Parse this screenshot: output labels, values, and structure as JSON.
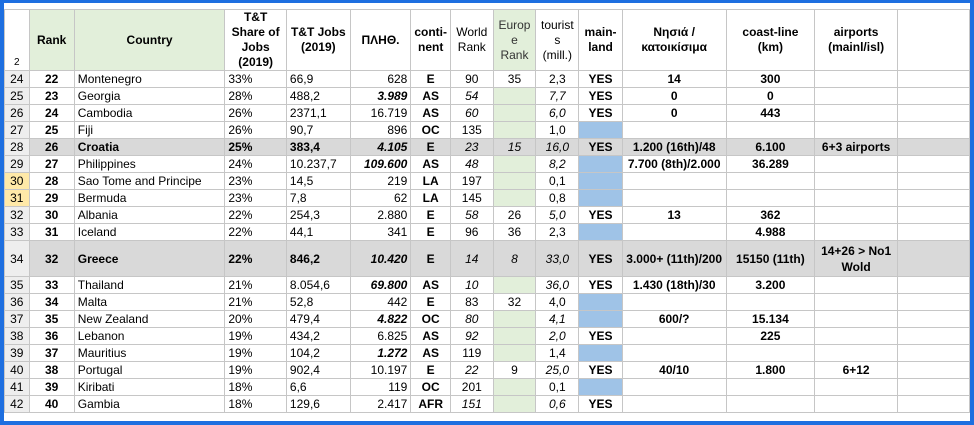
{
  "header": {
    "row_number": "2",
    "rank": "Rank",
    "country": "Country",
    "share": "T&T Share of Jobs (2019)",
    "jobs": "T&T Jobs (2019)",
    "pop": "ΠΛΗΘ.",
    "continent": "conti-nent",
    "world_rank": "World Rank",
    "europe_rank": "Europ e Rank",
    "tourists": "tourist s (mill.)",
    "mainland": "main-land",
    "islands": "Νησιά /κατοικίσιμα",
    "coastline": "coast-line (km)",
    "airports": "airports (mainl/isl)"
  },
  "rows": [
    {
      "n": "24",
      "rank": "22",
      "country": "Montenegro",
      "share": "33%",
      "jobs": "66,9",
      "pop": "628",
      "cont": "E",
      "wr": "90",
      "er": "35",
      "tour": "2,3",
      "main": "YES",
      "isl": "14",
      "coast": "300",
      "air": ""
    },
    {
      "n": "25",
      "rank": "23",
      "country": "Georgia",
      "share": "28%",
      "jobs": "488,2",
      "pop": "3.989",
      "cont": "AS",
      "wr": "54",
      "er": "",
      "tour": "7,7",
      "main": "YES",
      "isl": "0",
      "coast": "0",
      "air": ""
    },
    {
      "n": "26",
      "rank": "24",
      "country": "Cambodia",
      "share": "26%",
      "jobs": "2371,1",
      "pop": "16.719",
      "cont": "AS",
      "wr": "60",
      "er": "",
      "tour": "6,0",
      "main": "YES",
      "isl": "0",
      "coast": "443",
      "air": ""
    },
    {
      "n": "27",
      "rank": "25",
      "country": "Fiji",
      "share": "26%",
      "jobs": "90,7",
      "pop": "896",
      "cont": "OC",
      "wr": "135",
      "er": "",
      "tour": "1,0",
      "main": "",
      "isl": "",
      "coast": "",
      "air": ""
    },
    {
      "n": "28",
      "rank": "26",
      "country": "Croatia",
      "share": "25%",
      "jobs": "383,4",
      "pop": "4.105",
      "cont": "E",
      "wr": "23",
      "er": "15",
      "tour": "16,0",
      "main": "YES",
      "isl": "1.200 (16th)/48",
      "coast": "6.100",
      "air": "6+3 airports"
    },
    {
      "n": "29",
      "rank": "27",
      "country": "Philippines",
      "share": "24%",
      "jobs": "10.237,7",
      "pop": "109.600",
      "cont": "AS",
      "wr": "48",
      "er": "",
      "tour": "8,2",
      "main": "",
      "isl": "7.700 (8th)/2.000",
      "coast": "36.289",
      "air": ""
    },
    {
      "n": "30",
      "rank": "28",
      "country": "Sao Tome and Principe",
      "share": "23%",
      "jobs": "14,5",
      "pop": "219",
      "cont": "LA",
      "wr": "197",
      "er": "",
      "tour": "0,1",
      "main": "",
      "isl": "",
      "coast": "",
      "air": ""
    },
    {
      "n": "31",
      "rank": "29",
      "country": "Bermuda",
      "share": "23%",
      "jobs": "7,8",
      "pop": "62",
      "cont": "LA",
      "wr": "145",
      "er": "",
      "tour": "0,8",
      "main": "",
      "isl": "",
      "coast": "",
      "air": ""
    },
    {
      "n": "32",
      "rank": "30",
      "country": "Albania",
      "share": "22%",
      "jobs": "254,3",
      "pop": "2.880",
      "cont": "E",
      "wr": "58",
      "er": "26",
      "tour": "5,0",
      "main": "YES",
      "isl": "13",
      "coast": "362",
      "air": ""
    },
    {
      "n": "33",
      "rank": "31",
      "country": "Iceland",
      "share": "22%",
      "jobs": "44,1",
      "pop": "341",
      "cont": "E",
      "wr": "96",
      "er": "36",
      "tour": "2,3",
      "main": "",
      "isl": "",
      "coast": "4.988",
      "air": ""
    },
    {
      "n": "34",
      "rank": "32",
      "country": "Greece",
      "share": "22%",
      "jobs": "846,2",
      "pop": "10.420",
      "cont": "E",
      "wr": "14",
      "er": "8",
      "tour": "33,0",
      "main": "YES",
      "isl": "3.000+ (11th)/200",
      "coast": "15150 (11th)",
      "air": "14+26 > No1 Wold"
    },
    {
      "n": "35",
      "rank": "33",
      "country": "Thailand",
      "share": "21%",
      "jobs": "8.054,6",
      "pop": "69.800",
      "cont": "AS",
      "wr": "10",
      "er": "",
      "tour": "36,0",
      "main": "YES",
      "isl": "1.430 (18th)/30",
      "coast": "3.200",
      "air": ""
    },
    {
      "n": "36",
      "rank": "34",
      "country": "Malta",
      "share": "21%",
      "jobs": "52,8",
      "pop": "442",
      "cont": "E",
      "wr": "83",
      "er": "32",
      "tour": "4,0",
      "main": "",
      "isl": "",
      "coast": "",
      "air": ""
    },
    {
      "n": "37",
      "rank": "35",
      "country": "New Zealand",
      "share": "20%",
      "jobs": "479,4",
      "pop": "4.822",
      "cont": "OC",
      "wr": "80",
      "er": "",
      "tour": "4,1",
      "main": "",
      "isl": "600/?",
      "coast": "15.134",
      "air": ""
    },
    {
      "n": "38",
      "rank": "36",
      "country": "Lebanon",
      "share": "19%",
      "jobs": "434,2",
      "pop": "6.825",
      "cont": "AS",
      "wr": "92",
      "er": "",
      "tour": "2,0",
      "main": "YES",
      "isl": "",
      "coast": "225",
      "air": ""
    },
    {
      "n": "39",
      "rank": "37",
      "country": "Mauritius",
      "share": "19%",
      "jobs": "104,2",
      "pop": "1.272",
      "cont": "AS",
      "wr": "119",
      "er": "",
      "tour": "1,4",
      "main": "",
      "isl": "",
      "coast": "",
      "air": ""
    },
    {
      "n": "40",
      "rank": "38",
      "country": "Portugal",
      "share": "19%",
      "jobs": "902,4",
      "pop": "10.197",
      "cont": "E",
      "wr": "22",
      "er": "9",
      "tour": "25,0",
      "main": "YES",
      "isl": "40/10",
      "coast": "1.800",
      "air": "6+12"
    },
    {
      "n": "41",
      "rank": "39",
      "country": "Kiribati",
      "share": "18%",
      "jobs": "6,6",
      "pop": "119",
      "cont": "OC",
      "wr": "201",
      "er": "",
      "tour": "0,1",
      "main": "",
      "isl": "",
      "coast": "",
      "air": ""
    },
    {
      "n": "42",
      "rank": "40",
      "country": "Gambia",
      "share": "18%",
      "jobs": "129,6",
      "pop": "2.417",
      "cont": "AFR",
      "wr": "151",
      "er": "",
      "tour": "0,6",
      "main": "YES",
      "isl": "",
      "coast": "",
      "air": ""
    }
  ],
  "colors": {
    "frame": "#1e6fe0",
    "header_green": "#e2efda",
    "mainland_blue": "#9fc3e7",
    "highlight_red": "#e0191b",
    "gray_row": "#d9d9d9"
  }
}
